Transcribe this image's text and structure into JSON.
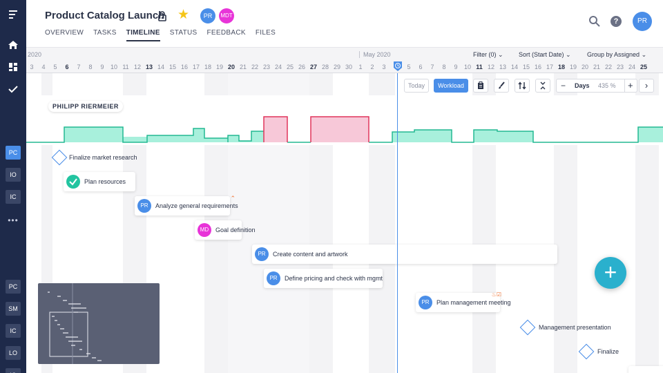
{
  "header": {
    "title": "Product Catalog Launch",
    "members": [
      "PR",
      "MDT"
    ],
    "user_avatar": "PR",
    "tabs": [
      "OVERVIEW",
      "TASKS",
      "TIMELINE",
      "STATUS",
      "FEEDBACK",
      "FILES"
    ],
    "active_tab": "TIMELINE"
  },
  "sidebar": {
    "top_icons": [
      "menu-icon",
      "home-icon",
      "dashboard-icon",
      "check-icon"
    ],
    "projects_group1": [
      "PC",
      "IO",
      "IC"
    ],
    "projects_group2": [
      "PC",
      "SM",
      "IC",
      "LO",
      "IO"
    ],
    "more_label": "•••"
  },
  "timeline": {
    "months": [
      "2020",
      "May 2020"
    ],
    "days_before": [
      "3",
      "4",
      "5",
      "6",
      "7",
      "8",
      "9",
      "10",
      "11",
      "12",
      "13",
      "14",
      "15",
      "16",
      "17",
      "18",
      "19",
      "20",
      "21",
      "22",
      "23",
      "24",
      "25",
      "26",
      "27",
      "28",
      "29",
      "30",
      "1",
      "2",
      "3"
    ],
    "days_after": [
      "5",
      "6",
      "7",
      "8",
      "9",
      "10",
      "11",
      "12",
      "13",
      "14",
      "15",
      "16",
      "17",
      "18",
      "19",
      "20",
      "21",
      "22",
      "23",
      "24",
      "25"
    ],
    "filter_label": "Filter (0)",
    "sort_label": "Sort (Start Date)",
    "group_label": "Group by Assigned"
  },
  "toolbar": {
    "today_label": "Today",
    "workload_label": "Workload",
    "scale_label": "Days",
    "zoom_value": "435 %",
    "minus_label": "−",
    "plus_label": "+",
    "next_label": "›"
  },
  "workload": {
    "person": "PHILIPP RIERMEIER"
  },
  "tasks": [
    {
      "kind": "milestone",
      "label": "Finalize market research"
    },
    {
      "kind": "done",
      "label": "Plan resources"
    },
    {
      "kind": "task",
      "avatar": "PR",
      "label": "Analyze general requirements"
    },
    {
      "kind": "task",
      "avatar": "MD",
      "label": "Goal definition"
    },
    {
      "kind": "task",
      "avatar": "PR",
      "label": "Create content and artwork"
    },
    {
      "kind": "task",
      "avatar": "PR",
      "label": "Define pricing and check with mgmt"
    },
    {
      "kind": "task",
      "avatar": "PR",
      "label": "Plan management meeting"
    },
    {
      "kind": "milestone",
      "label": "Management presentation"
    },
    {
      "kind": "milestone",
      "label": "Finalize"
    }
  ],
  "colors": {
    "accent": "#4a8ee8",
    "sidebar": "#1e2a4a",
    "workload_ok": "#a8f0dc",
    "workload_over": "#f7c8d8",
    "fab": "#2ab0cd"
  }
}
